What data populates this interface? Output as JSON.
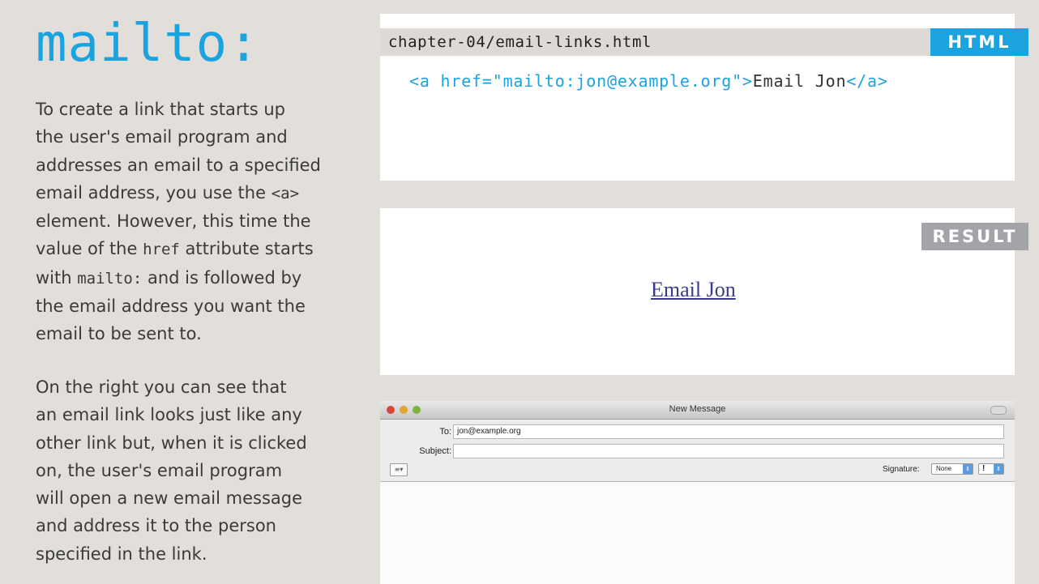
{
  "heading": "mailto:",
  "paragraph1": [
    [
      {
        "t": "To create a link that starts up"
      }
    ],
    [
      {
        "t": "the user's email program and"
      }
    ],
    [
      {
        "t": "addresses an email to a specified"
      }
    ],
    [
      {
        "t": "email address, you use the "
      },
      {
        "t": "<a>",
        "mono": true
      }
    ],
    [
      {
        "t": "element. However, this time the"
      }
    ],
    [
      {
        "t": "value of the "
      },
      {
        "t": "href",
        "mono": true
      },
      {
        "t": " attribute starts"
      }
    ],
    [
      {
        "t": "with "
      },
      {
        "t": "mailto:",
        "mono": true
      },
      {
        "t": " and is followed by"
      }
    ],
    [
      {
        "t": "the email address you want the"
      }
    ],
    [
      {
        "t": "email to be sent to."
      }
    ]
  ],
  "paragraph2": [
    [
      {
        "t": "On the right you can see that"
      }
    ],
    [
      {
        "t": "an email link looks just like any"
      }
    ],
    [
      {
        "t": "other link but, when it is clicked"
      }
    ],
    [
      {
        "t": "on, the user's email program"
      }
    ],
    [
      {
        "t": "will open a new email message"
      }
    ],
    [
      {
        "t": "and address it to the person"
      }
    ],
    [
      {
        "t": "specified in the link."
      }
    ]
  ],
  "code_panel": {
    "file_name": "chapter-04/email-links.html",
    "tag_label": "HTML",
    "code_open": "<a href=\"mailto:jon@example.org\">",
    "code_text": "Email Jon",
    "code_close": "</a>"
  },
  "result_panel": {
    "tag_label": "RESULT",
    "link_text": "Email Jon"
  },
  "mail_window": {
    "title": "New Message",
    "to_label": "To:",
    "to_value": "jon@example.org",
    "subject_label": "Subject:",
    "signature_label": "Signature:",
    "signature_value": "None",
    "priority_value": "!"
  },
  "colors": {
    "accent": "#1ba3df",
    "background": "#e2dfdb",
    "result_tag": "#a2a4a7",
    "link": "#3c3a8c"
  }
}
